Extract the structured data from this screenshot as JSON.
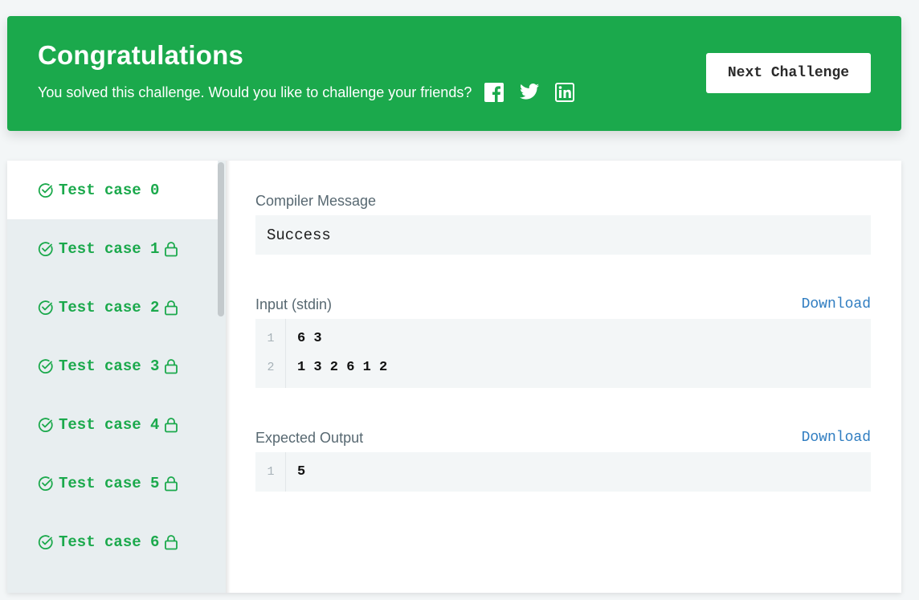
{
  "banner": {
    "title": "Congratulations",
    "subtitle": "You solved this challenge. Would you like to challenge your friends?",
    "next_button": "Next Challenge",
    "social_icons": [
      "facebook-icon",
      "twitter-icon",
      "linkedin-icon"
    ]
  },
  "test_cases": [
    {
      "label": "Test case 0",
      "locked": false,
      "active": true
    },
    {
      "label": "Test case 1",
      "locked": true,
      "active": false
    },
    {
      "label": "Test case 2",
      "locked": true,
      "active": false
    },
    {
      "label": "Test case 3",
      "locked": true,
      "active": false
    },
    {
      "label": "Test case 4",
      "locked": true,
      "active": false
    },
    {
      "label": "Test case 5",
      "locked": true,
      "active": false
    },
    {
      "label": "Test case 6",
      "locked": true,
      "active": false
    }
  ],
  "compiler": {
    "label": "Compiler Message",
    "message": "Success"
  },
  "input": {
    "label": "Input (stdin)",
    "download": "Download",
    "lines": [
      {
        "n": "1",
        "text": "6 3"
      },
      {
        "n": "2",
        "text": "1 3 2 6 1 2"
      }
    ]
  },
  "expected": {
    "label": "Expected Output",
    "download": "Download",
    "lines": [
      {
        "n": "1",
        "text": "5"
      }
    ]
  },
  "colors": {
    "success_green": "#1ba94c",
    "link_blue": "#2f7dc1",
    "sidebar_bg": "#e8eef0"
  }
}
